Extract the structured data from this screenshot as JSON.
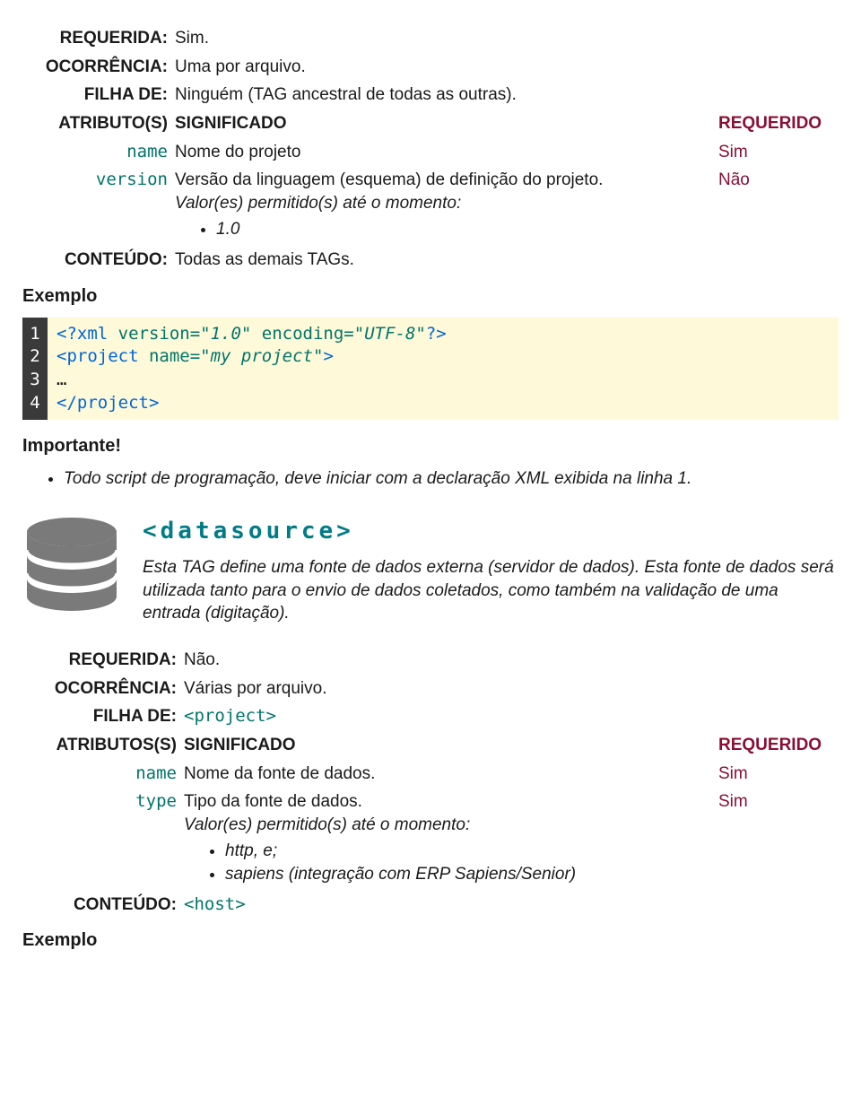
{
  "section1": {
    "rows": [
      {
        "label": "REQUERIDA:",
        "value": "Sim."
      },
      {
        "label": "OCORRÊNCIA:",
        "value": "Uma por arquivo."
      },
      {
        "label": "FILHA DE:",
        "value": "Ninguém (TAG ancestral de todas as outras)."
      }
    ],
    "attr_header": {
      "label": "ATRIBUTO(S)",
      "sig": "SIGNIFICADO",
      "req": "REQUERIDO"
    },
    "attrs": [
      {
        "name": "name",
        "sig": "Nome do projeto",
        "req": "Sim"
      },
      {
        "name": "version",
        "sig": "Versão da linguagem (esquema) de definição do projeto.",
        "req": "Não",
        "perm_label": "Valor(es) permitido(s) até o momento:",
        "perm_values": [
          "1.0"
        ]
      }
    ],
    "content": {
      "label": "CONTEÚDO:",
      "value": "Todas as demais TAGs."
    }
  },
  "example1": {
    "heading": "Exemplo",
    "line_numbers": [
      "1",
      "2",
      "3",
      "4"
    ],
    "code": {
      "l1": {
        "a": "<?xml ",
        "b": "version=",
        "c": "\"1.0\"",
        "d": " encoding=",
        "e": "\"UTF-8\"",
        "f": "?>"
      },
      "l2": {
        "a": "<project ",
        "b": "name=",
        "c": "\"my project\"",
        "d": ">"
      },
      "l3": "…",
      "l4": "</project>"
    }
  },
  "important": {
    "heading": "Importante!",
    "bullet": "Todo script de programação, deve iniciar com a declaração XML exibida na linha 1."
  },
  "datasource": {
    "title": "<datasource>",
    "desc": "Esta TAG define uma fonte de dados externa (servidor de dados). Esta fonte de dados será utilizada tanto para o envio de dados coletados, como também na validação de uma entrada (digitação)."
  },
  "section2": {
    "rows": [
      {
        "label": "REQUERIDA:",
        "value": "Não."
      },
      {
        "label": "OCORRÊNCIA:",
        "value": "Várias por arquivo."
      },
      {
        "label": "FILHA DE:",
        "value": "<project>",
        "mono": true
      }
    ],
    "attr_header": {
      "label": "ATRIBUTOS(S)",
      "sig": "SIGNIFICADO",
      "req": "REQUERIDO"
    },
    "attrs": [
      {
        "name": "name",
        "sig": "Nome da fonte de dados.",
        "req": "Sim"
      },
      {
        "name": "type",
        "sig": "Tipo da fonte de dados.",
        "req": "Sim",
        "perm_label": "Valor(es) permitido(s) até o momento:",
        "perm_values": [
          "http, e;",
          "sapiens (integração com ERP Sapiens/Senior)"
        ]
      }
    ],
    "content": {
      "label": "CONTEÚDO:",
      "value": "<host>",
      "mono": true
    },
    "example_heading": "Exemplo"
  }
}
